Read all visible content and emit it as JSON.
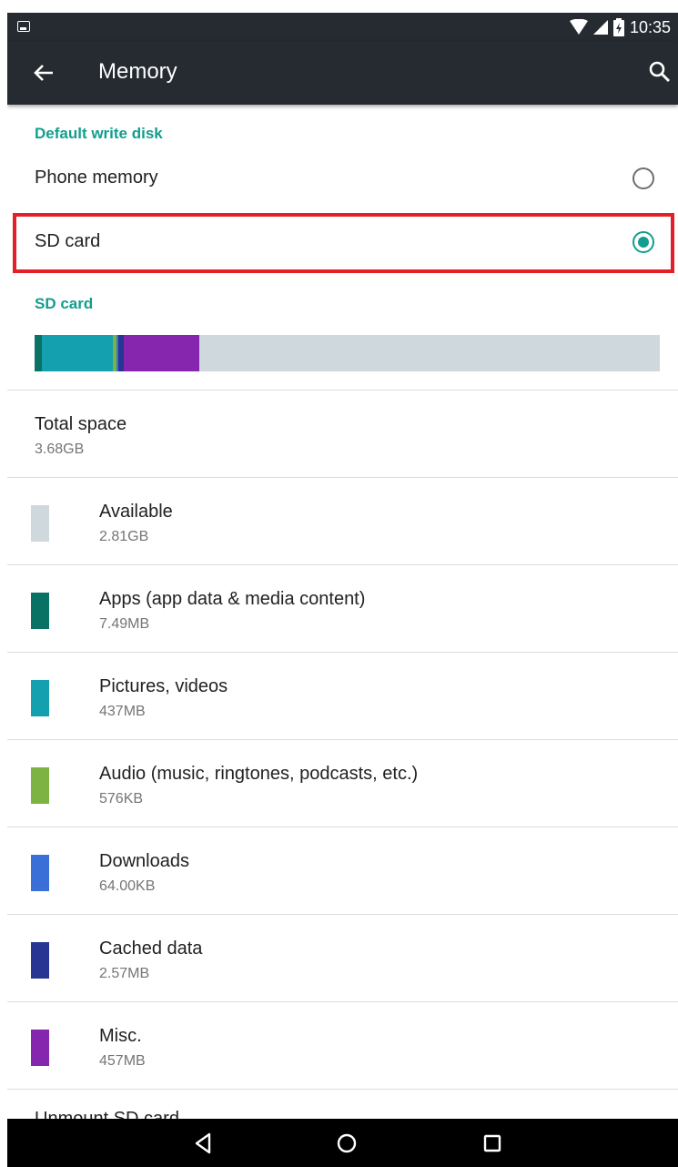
{
  "status_bar": {
    "time": "10:35",
    "icons": [
      "image-notification-icon",
      "wifi-icon",
      "cell-signal-icon",
      "battery-icon"
    ]
  },
  "toolbar": {
    "title": "Memory",
    "back_icon": "back-arrow-icon",
    "search_icon": "search-icon"
  },
  "default_write_disk": {
    "header": "Default write disk",
    "options": [
      {
        "label": "Phone memory",
        "selected": false
      },
      {
        "label": "SD card",
        "selected": true
      }
    ]
  },
  "sd_card": {
    "header": "SD card",
    "usage_bar": {
      "background_color": "#cfd8dc",
      "segments": [
        {
          "name": "apps",
          "share": 0.011,
          "color": "#0a7264"
        },
        {
          "name": "pictures-videos",
          "share": 0.114,
          "color": "#14a0ae"
        },
        {
          "name": "audio",
          "share": 0.006,
          "color": "#7cb342"
        },
        {
          "name": "downloads",
          "share": 0.003,
          "color": "#3a6fd8"
        },
        {
          "name": "cached-data",
          "share": 0.009,
          "color": "#283593"
        },
        {
          "name": "misc",
          "share": 0.12,
          "color": "#8625ad"
        }
      ]
    },
    "total": {
      "title": "Total space",
      "value": "3.68GB"
    },
    "categories": [
      {
        "title": "Available",
        "size": "2.81GB",
        "color": "#cfd8dc"
      },
      {
        "title": "Apps (app data & media content)",
        "size": "7.49MB",
        "color": "#0a7264"
      },
      {
        "title": "Pictures, videos",
        "size": "437MB",
        "color": "#14a0ae"
      },
      {
        "title": "Audio (music, ringtones, podcasts, etc.)",
        "size": "576KB",
        "color": "#7cb342"
      },
      {
        "title": "Downloads",
        "size": "64.00KB",
        "color": "#3a6fd8"
      },
      {
        "title": "Cached data",
        "size": "2.57MB",
        "color": "#283593"
      },
      {
        "title": "Misc.",
        "size": "457MB",
        "color": "#8625ad"
      }
    ],
    "cut_off_item": "Unmount SD card"
  },
  "navigation_bar": {
    "buttons": [
      "back-triangle-icon",
      "home-circle-icon",
      "recents-square-icon"
    ]
  },
  "colors": {
    "accent": "#129e8e",
    "highlight": "#e3202a",
    "toolbar": "#262b31"
  }
}
